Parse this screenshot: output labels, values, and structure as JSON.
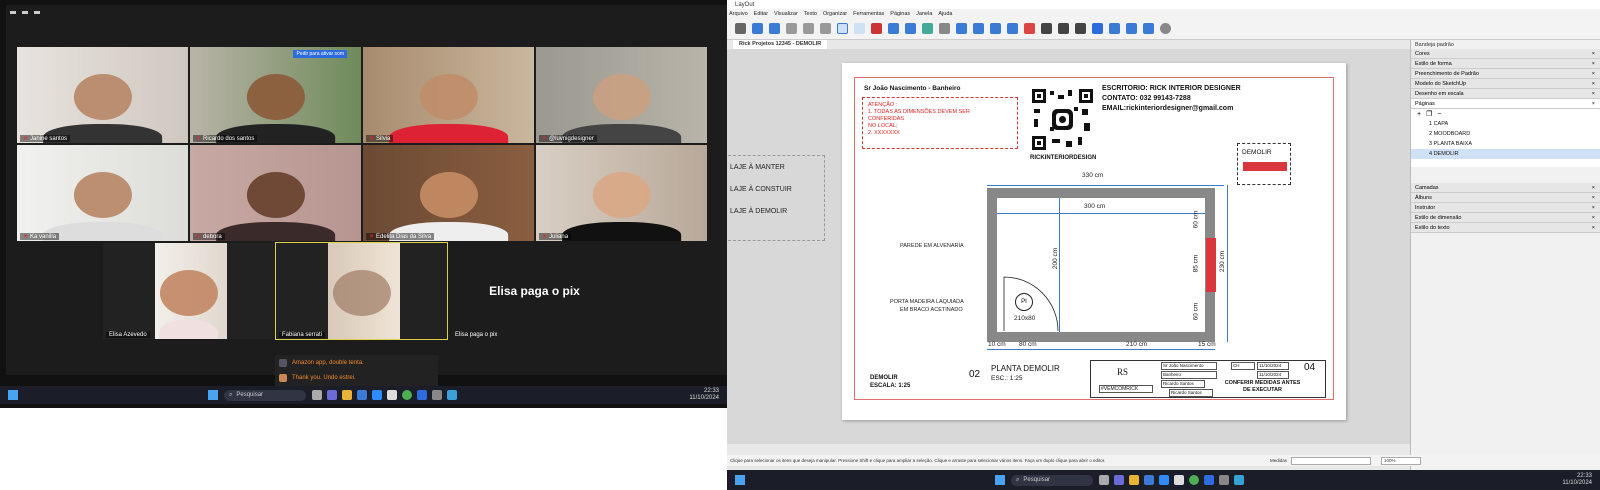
{
  "left": {
    "participants": [
      {
        "name": "Janine santos"
      },
      {
        "name": "Ricardo dos santos"
      },
      {
        "name": "Silvia"
      },
      {
        "name": "@luvnigdesigner"
      },
      {
        "name": "Ka vanilla"
      },
      {
        "name": "debora"
      },
      {
        "name": "Edelita Dias da Silva"
      },
      {
        "name": "Juliana"
      },
      {
        "name": "Elisa Azevedo"
      },
      {
        "name": "Fabiana serrati"
      },
      {
        "name": "Elisa paga o pix"
      }
    ],
    "spotlight_text": "Elisa paga o pix",
    "tile_chip": "Pedir para ativar som",
    "notifications": [
      "Amazon app, double tenta.",
      "Thank you. Undo estrei."
    ],
    "taskbar": {
      "search_placeholder": "Pesquisar",
      "time": "22:33",
      "date": "11/10/2024"
    }
  },
  "right": {
    "app_title": "LayOut",
    "menu": [
      "Arquivo",
      "Editar",
      "Visualizar",
      "Texto",
      "Organizar",
      "Ferramentas",
      "Páginas",
      "Janela",
      "Ajuda"
    ],
    "doc_tab": "Rick Projetos 12345 - DEMOLIR",
    "sheet": {
      "client": "Sr João Nascimento  -  Banheiro",
      "attention": [
        "ATENÇÃO :",
        "1. TODAS AS DIMENSÕES DEVEM SER",
        "CONFERIDAS",
        "NO LOCAL;",
        "2. XXXXXXX"
      ],
      "qr_caption": "RICKINTERIORDESIGN",
      "office": "ESCRITORIO: RICK INTERIOR DESIGNER",
      "contact": "CONTATO: 032 99143-7288",
      "email": "EMAIL:rickinteriordesigner@gmail.com",
      "demolir_legend": "DEMOLIR",
      "dims": {
        "top": "330 cm",
        "inner": "300 cm",
        "left_h": "200 cm",
        "right_h": "230 cm",
        "w1": "60 cm",
        "w2": "85 cm",
        "w3": "60 cm",
        "b1": "10 cm",
        "b2": "80 cm",
        "b3": "210 cm",
        "b4": "15 cm"
      },
      "labels": {
        "wall": "PAREDE EM ALVENARIA",
        "door1": "PORTA MADEIRA LAQUIADA",
        "door2": "EM BRACO ACETINADO",
        "pi": "PI",
        "pi_dim": "210x80"
      },
      "plan_num": "02",
      "plan_title": "PLANTA DEMOLIR",
      "plan_scale": "ESC.: 1:25",
      "foot1": "DEMOLIR",
      "foot2": "ESCALA: 1:25",
      "tb": {
        "logo": "RS",
        "tag": "#VEMCOMRICK",
        "c1": "Sr João Nascimento",
        "c2": "Banheiro",
        "c3": "Ricardo Santos",
        "c4": "Ricardo Santos",
        "c5": "CH",
        "d1": "11/10/2024",
        "d2": "11/10/2024",
        "note": "CONFERIR MEDIDAS ANTES DE EXECUTAR",
        "page": "04"
      }
    },
    "legend": [
      "LAJE À MANTER",
      "LAJE À CONSTUIR",
      "LAJE À DEMOLIR"
    ],
    "panel": {
      "title": "Bandeja padrão",
      "sections": [
        "Cores",
        "Estilo de forma",
        "Preenchimento de Padrão",
        "Modelo do SketchUp",
        "Desenho em escala",
        "Páginas"
      ],
      "pages": [
        "1  CAPA",
        "2  MOODBOARD",
        "3  PLANTA BAIXA",
        "4  DEMOLIR"
      ],
      "sections2": [
        "Camadas",
        "Álbuns",
        "Instrutor",
        "Estilo de dimensão",
        "Estilo do texto"
      ]
    },
    "status": "Clique para selecionar os itens que deseja manipular. Pressione Shift e clique para ampliar a seleção. Clique e arraste para selecionar vários itens. Faça um duplo clique para abrir o editor.",
    "measure_label": "Medidas",
    "zoom": "100%",
    "taskbar": {
      "search_placeholder": "Pesquisar",
      "time": "22:33",
      "date": "11/10/2024"
    }
  }
}
